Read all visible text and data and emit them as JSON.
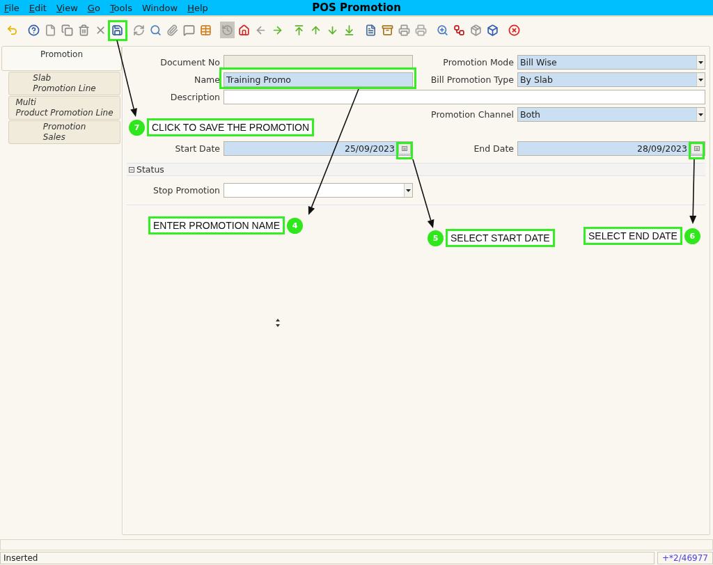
{
  "window": {
    "title": "POS Promotion"
  },
  "menu": [
    {
      "label": "File",
      "mnemonic": true
    },
    {
      "label": "Edit",
      "mnemonic": true
    },
    {
      "label": "View",
      "mnemonic": true
    },
    {
      "label": "Go",
      "mnemonic": true
    },
    {
      "label": "Tools",
      "mnemonic": true
    },
    {
      "label": "Window",
      "mnemonic": false
    },
    {
      "label": "Help",
      "mnemonic": true
    }
  ],
  "tabs": [
    {
      "lines": [
        "Promotion"
      ],
      "selected": true
    },
    {
      "lines": [
        "Slab",
        "Promotion Line"
      ],
      "selected": false
    },
    {
      "lines": [
        "Multi",
        "Product Promotion Line"
      ],
      "selected": false
    },
    {
      "lines": [
        "Promotion",
        "Sales"
      ],
      "selected": false
    }
  ],
  "form": {
    "rows": [
      {
        "fields": [
          {
            "label": "Document No",
            "kind": "text",
            "readonly": true,
            "mandatory": false
          },
          {
            "label": "Promotion Mode",
            "kind": "dropdown",
            "value": "Bill Wise",
            "readonly": false,
            "mandatory": true
          }
        ]
      },
      {
        "fields": [
          {
            "label": "Name",
            "kind": "text",
            "value": "Training Promo",
            "readonly": false,
            "mandatory": true
          },
          {
            "label": "Bill Promotion Type",
            "kind": "dropdown",
            "value": "By Slab",
            "readonly": false,
            "mandatory": true
          }
        ]
      },
      {
        "fields": [
          {
            "label": "Description",
            "kind": "wide",
            "readonly": false,
            "mandatory": false
          }
        ]
      },
      {
        "fields": [
          {
            "label": "Promotion Channel",
            "kind": "dropdown",
            "value": "Both",
            "readonly": false,
            "mandatory": true
          }
        ]
      },
      {
        "fields": [
          {
            "label": "Start Date",
            "kind": "date",
            "value": "25/09/2023",
            "readonly": false,
            "mandatory": true
          },
          {
            "label": "End Date",
            "kind": "date",
            "value": "28/09/2023",
            "readonly": false,
            "mandatory": true
          }
        ]
      }
    ]
  },
  "status_section": {
    "title": "Status",
    "expanded": true,
    "fields": [
      {
        "label": "Stop Promotion",
        "kind": "dropdown",
        "readonly": false,
        "mandatory": false
      }
    ]
  },
  "annotations": [
    {
      "number": "7",
      "text": "CLICK TO SAVE THE PROMOTION"
    },
    {
      "number": "4",
      "text": "ENTER PROMOTION NAME"
    },
    {
      "number": "5",
      "text": "SELECT START DATE"
    },
    {
      "number": "6",
      "text": "SELECT END DATE"
    }
  ],
  "status_bar": {
    "message": "Inserted",
    "record": "+*2/46977"
  }
}
